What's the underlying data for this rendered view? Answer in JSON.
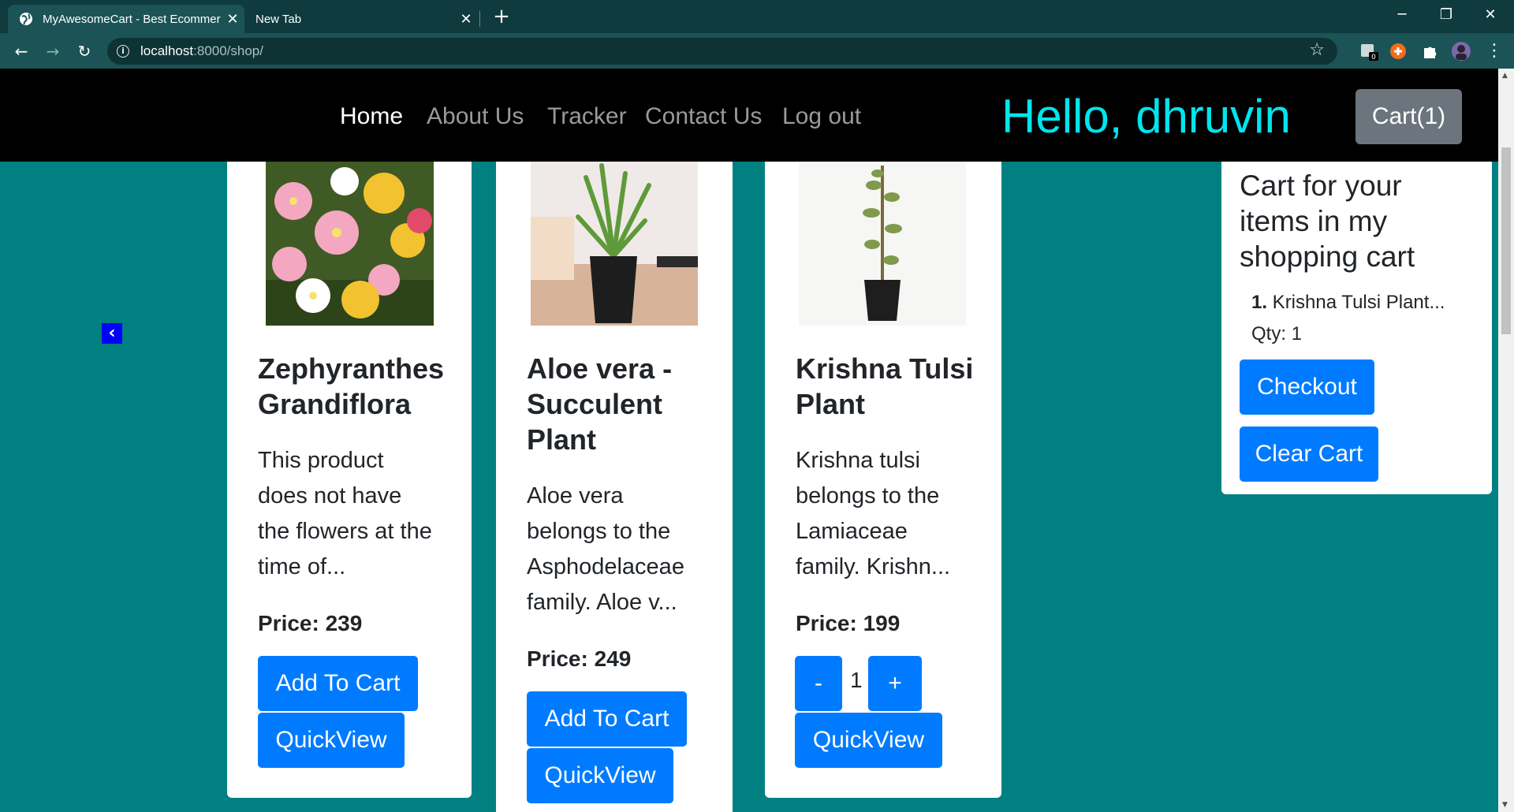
{
  "browser": {
    "tabs": [
      {
        "title": "MyAwesomeCart - Best Ecommerce",
        "active": true
      },
      {
        "title": "New Tab",
        "active": false
      }
    ],
    "url_host": "localhost",
    "url_rest": ":8000/shop/",
    "extension_badge": "0"
  },
  "nav": {
    "links": [
      "Home",
      "About Us",
      "Tracker",
      "Contact Us",
      "Log out"
    ],
    "greeting": "Hello, dhruvin",
    "cart_button": "Cart(1)"
  },
  "products": [
    {
      "name_lines": [
        "Zephyranthes",
        "Grandiflora"
      ],
      "desc_lines": [
        "This product",
        "does not have",
        "the flowers at the",
        "time of..."
      ],
      "price": "Price: 239",
      "add_label": "Add To Cart",
      "quickview_label": "QuickView"
    },
    {
      "name_lines": [
        "Aloe vera -",
        "Succulent",
        "Plant"
      ],
      "desc_lines": [
        "Aloe vera",
        "belongs to the",
        "Asphodelaceae",
        "family. Aloe v..."
      ],
      "price": "Price: 249",
      "add_label": "Add To Cart",
      "quickview_label": "QuickView"
    },
    {
      "name_lines": [
        "Krishna Tulsi",
        "Plant"
      ],
      "desc_lines": [
        "Krishna tulsi",
        "belongs to the",
        "Lamiaceae",
        "family. Krishn..."
      ],
      "price": "Price: 199",
      "minus_label": "-",
      "qty": "1",
      "plus_label": "+",
      "quickview_label": "QuickView"
    }
  ],
  "cart_panel": {
    "title": "Cart for your items in my shopping cart",
    "item_index": "1.",
    "item_name": " Krishna Tulsi Plant...",
    "item_qty": "Qty: 1",
    "checkout_label": "Checkout",
    "clear_label": "Clear Cart"
  },
  "colors": {
    "page_bg": "#008080",
    "nav_bg": "#000000",
    "greeting": "#00e5ee",
    "primary_button": "#007bff",
    "cart_button": "#6c757d"
  }
}
